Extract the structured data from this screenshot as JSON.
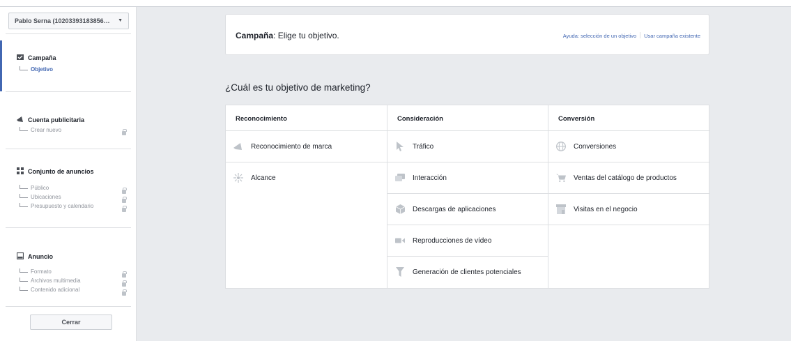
{
  "sidebar": {
    "account_selector": "Pablo Serna (10203393183856…",
    "campaign": {
      "title": "Campaña",
      "sub": "Objetivo"
    },
    "ad_account": {
      "title": "Cuenta publicitaria",
      "sub": "Crear nuevo"
    },
    "ad_set": {
      "title": "Conjunto de anuncios",
      "items": [
        "Público",
        "Ubicaciones",
        "Presupuesto y calendario"
      ]
    },
    "ad": {
      "title": "Anuncio",
      "items": [
        "Formato",
        "Archivos multimedia",
        "Contenido adicional"
      ]
    },
    "close_label": "Cerrar"
  },
  "header": {
    "title_bold": "Campaña",
    "title_rest": ": Elige tu objetivo.",
    "help_link": "Ayuda: selección de un objetivo",
    "existing_link": "Usar campaña existente"
  },
  "question": "¿Cuál es tu objetivo de marketing?",
  "objectives": {
    "awareness": {
      "title": "Reconocimiento",
      "items": [
        "Reconocimiento de marca",
        "Alcance"
      ]
    },
    "consideration": {
      "title": "Consideración",
      "items": [
        "Tráfico",
        "Interacción",
        "Descargas de aplicaciones",
        "Reproducciones de vídeo",
        "Generación de clientes potenciales"
      ]
    },
    "conversion": {
      "title": "Conversión",
      "items": [
        "Conversiones",
        "Ventas del catálogo de productos",
        "Visitas en el negocio"
      ]
    }
  },
  "colors": {
    "accent": "#4267b2",
    "icon_gray": "#bec3c9",
    "background": "#e9ebee"
  }
}
